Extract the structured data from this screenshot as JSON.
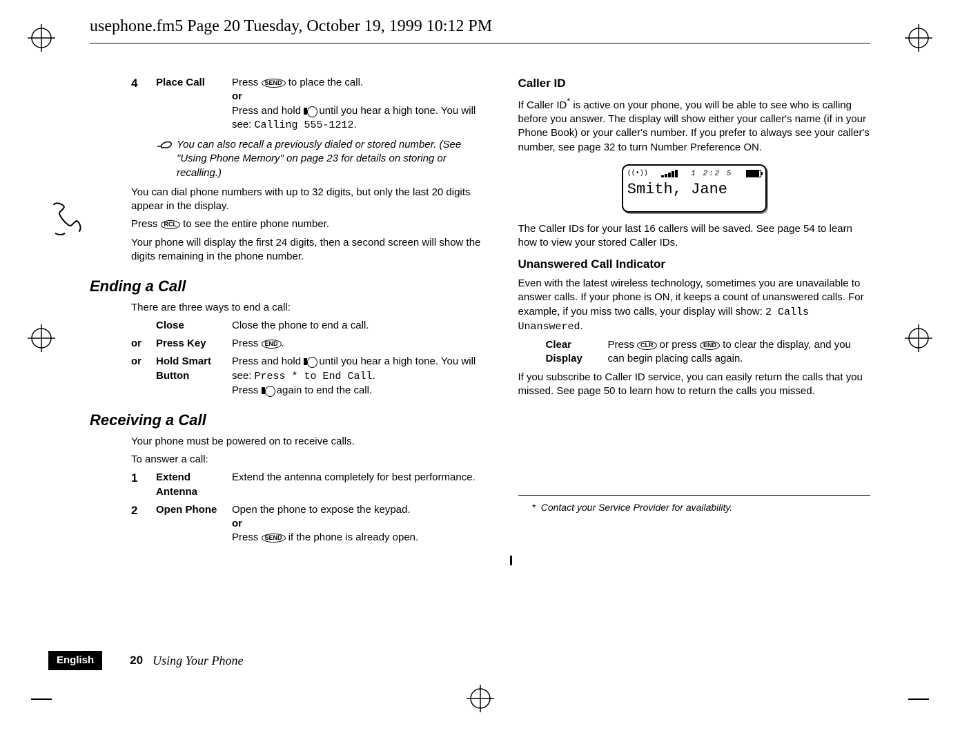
{
  "header": "usephone.fm5  Page 20  Tuesday, October 19, 1999  10:12 PM",
  "left": {
    "step4": {
      "num": "4",
      "label": "Place Call",
      "line1_pre": "Press ",
      "line1_key": "SEND",
      "line1_post": " to place the call.",
      "or": "or",
      "line2_pre": "Press and hold ",
      "line2_post": " until you hear a high tone. You will see: ",
      "line2_mono": "Calling 555-1212",
      "line2_dot": "."
    },
    "note": "You can also recall a previously dialed or stored number. (See \"Using Phone Memory\" on page 23 for details on storing or recalling.)",
    "p1": "You can dial phone numbers with up to 32 digits, but only the last 20 digits appear in the display.",
    "p2_pre": "Press ",
    "p2_key": "RCL",
    "p2_post": " to see the entire phone number.",
    "p3": "Your phone will display the first 24 digits, then a second screen will show the digits remaining in the phone number.",
    "ending_head": "Ending a Call",
    "ending_intro": "There are three ways to end a call:",
    "row_close_label": "Close",
    "row_close_body": "Close the phone to end a call.",
    "row_key_or": "or",
    "row_key_label": "Press Key",
    "row_key_body_pre": "Press ",
    "row_key_key": "END",
    "row_key_body_post": ".",
    "row_smart_or": "or",
    "row_smart_label": "Hold Smart Button",
    "row_smart_body_pre": "Press and hold ",
    "row_smart_body_post": " until you hear a high tone. You will see: ",
    "row_smart_mono": "Press * to End Call",
    "row_smart_dot": ".",
    "row_smart_line2_pre": "Press ",
    "row_smart_line2_post": " again to end the call.",
    "recv_head": "Receiving a Call",
    "recv_p1": "Your phone must be powered on to receive calls.",
    "recv_p2": "To answer a call:",
    "recv1_num": "1",
    "recv1_label": "Extend Antenna",
    "recv1_body": "Extend the antenna completely for best performance.",
    "recv2_num": "2",
    "recv2_label": "Open Phone",
    "recv2_body": "Open the phone to expose the keypad.",
    "recv2_or": "or",
    "recv2_line2_pre": "Press ",
    "recv2_line2_key": "SEND",
    "recv2_line2_post": " if the phone is already open."
  },
  "right": {
    "cid_head": "Caller ID",
    "cid_p1_a": "If Caller ID",
    "cid_p1_star": "*",
    "cid_p1_b": " is active on your phone, you will be able to see who is calling before you answer. The display will show either your caller's name (if in your Phone Book) or your caller's number. If you prefer to always see your caller's number, see page 32 to turn Number Preference ON.",
    "lcd_time": "1 2:2 5",
    "lcd_text": "Smith, Jane",
    "cid_p2": "The Caller IDs for your last 16 callers will be saved. See page 54 to learn how to view your stored Caller IDs.",
    "unans_head": "Unanswered Call Indicator",
    "unans_p1_a": "Even with the latest wireless technology, sometimes you are unavailable to answer calls. If your phone is ON, it keeps a count of unanswered calls. For example, if you miss two calls, your display will show: ",
    "unans_p1_mono": "2 Calls Unanswered",
    "unans_p1_dot": ".",
    "clear_label": "Clear Display",
    "clear_body_pre": "Press ",
    "clear_key1": "CLR",
    "clear_body_mid": " or press ",
    "clear_key2": "END",
    "clear_body_post": " to clear the display, and you can begin placing calls again.",
    "cid_p3": "If you subscribe to Caller ID service, you can easily return the calls that you missed. See page 50 to learn how to return the calls you missed.",
    "footnote_star": "*",
    "footnote_text": "Contact your Service Provider for availability."
  },
  "footer": {
    "lang": "English",
    "page": "20",
    "title": "Using Your Phone"
  }
}
